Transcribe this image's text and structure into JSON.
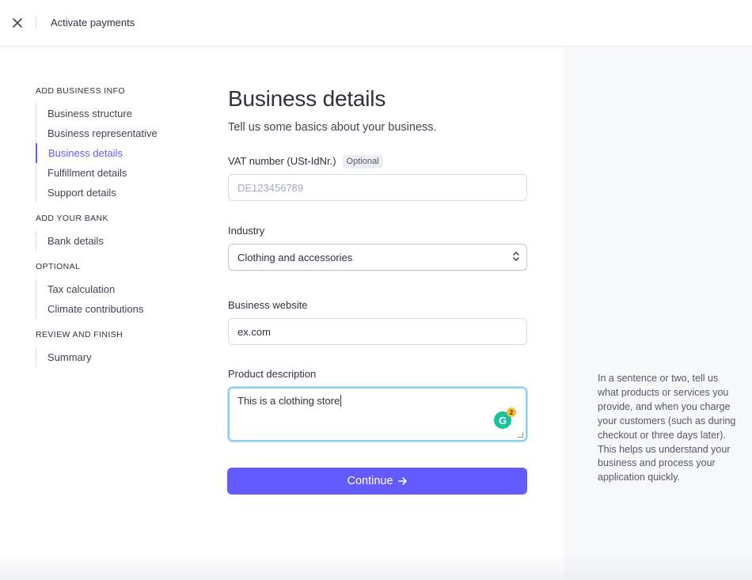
{
  "window": {
    "title": "Activate payments",
    "close_icon": "close-icon"
  },
  "sidebar": {
    "sections": [
      {
        "title": "ADD BUSINESS INFO",
        "items": [
          {
            "label": "Business structure",
            "active": false
          },
          {
            "label": "Business representative",
            "active": false
          },
          {
            "label": "Business details",
            "active": true
          },
          {
            "label": "Fulfillment details",
            "active": false
          },
          {
            "label": "Support details",
            "active": false
          }
        ]
      },
      {
        "title": "ADD YOUR BANK",
        "items": [
          {
            "label": "Bank details",
            "active": false
          }
        ]
      },
      {
        "title": "OPTIONAL",
        "items": [
          {
            "label": "Tax calculation",
            "active": false
          },
          {
            "label": "Climate contributions",
            "active": false
          }
        ]
      },
      {
        "title": "REVIEW AND FINISH",
        "items": [
          {
            "label": "Summary",
            "active": false
          }
        ]
      }
    ]
  },
  "main": {
    "title": "Business details",
    "subtitle": "Tell us some basics about your business.",
    "vat": {
      "label": "VAT number (USt-IdNr.)",
      "badge": "Optional",
      "placeholder": "DE123456789",
      "value": ""
    },
    "industry": {
      "label": "Industry",
      "value": "Clothing and accessories",
      "icon": "chevron-updown-icon"
    },
    "website": {
      "label": "Business website",
      "value": "ex.com"
    },
    "product": {
      "label": "Product description",
      "value": "This is a clothing store",
      "grammarly_count": "2"
    },
    "continue_label": "Continue",
    "continue_icon": "arrow-right-icon"
  },
  "help": {
    "text": "In a sentence or two, tell us what products or services you provide, and when you charge your customers (such as during checkout or three days later). This helps us understand your business and process your application quickly."
  },
  "colors": {
    "accent": "#635bff",
    "focus": "#90cdf4",
    "panel": "#f6f8fa"
  }
}
